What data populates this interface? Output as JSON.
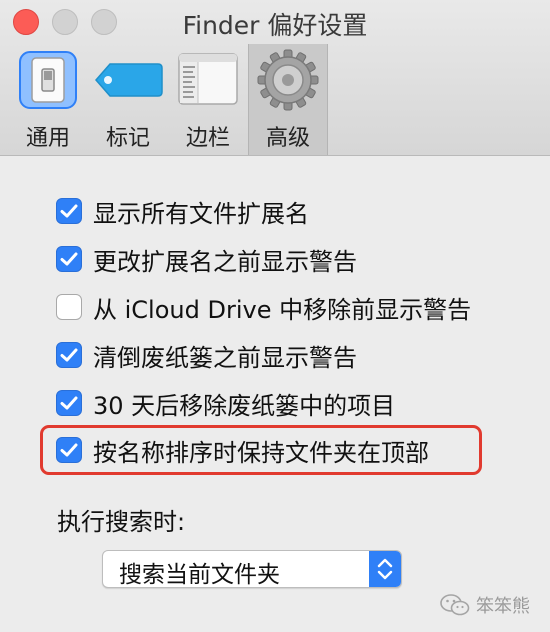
{
  "window": {
    "title": "Finder 偏好设置"
  },
  "toolbar": {
    "tabs": [
      {
        "label": "通用",
        "icon": "general-switch-icon",
        "active": false
      },
      {
        "label": "标记",
        "icon": "tag-icon",
        "active": false
      },
      {
        "label": "边栏",
        "icon": "sidebar-icon",
        "active": false
      },
      {
        "label": "高级",
        "icon": "gear-icon",
        "active": true
      }
    ]
  },
  "options": [
    {
      "label": "显示所有文件扩展名",
      "checked": true
    },
    {
      "label": "更改扩展名之前显示警告",
      "checked": true
    },
    {
      "label": "从 iCloud Drive 中移除前显示警告",
      "checked": false
    },
    {
      "label": "清倒废纸篓之前显示警告",
      "checked": true
    },
    {
      "label": "30 天后移除废纸篓中的项目",
      "checked": true
    },
    {
      "label": "按名称排序时保持文件夹在顶部",
      "checked": true
    }
  ],
  "search": {
    "label": "执行搜索时:",
    "selected": "搜索当前文件夹"
  },
  "watermark": {
    "text": "笨笨熊",
    "icon": "wechat-icon"
  },
  "colors": {
    "accent": "#2f80f7",
    "highlight": "#e13a2f",
    "close": "#fc5c56"
  }
}
